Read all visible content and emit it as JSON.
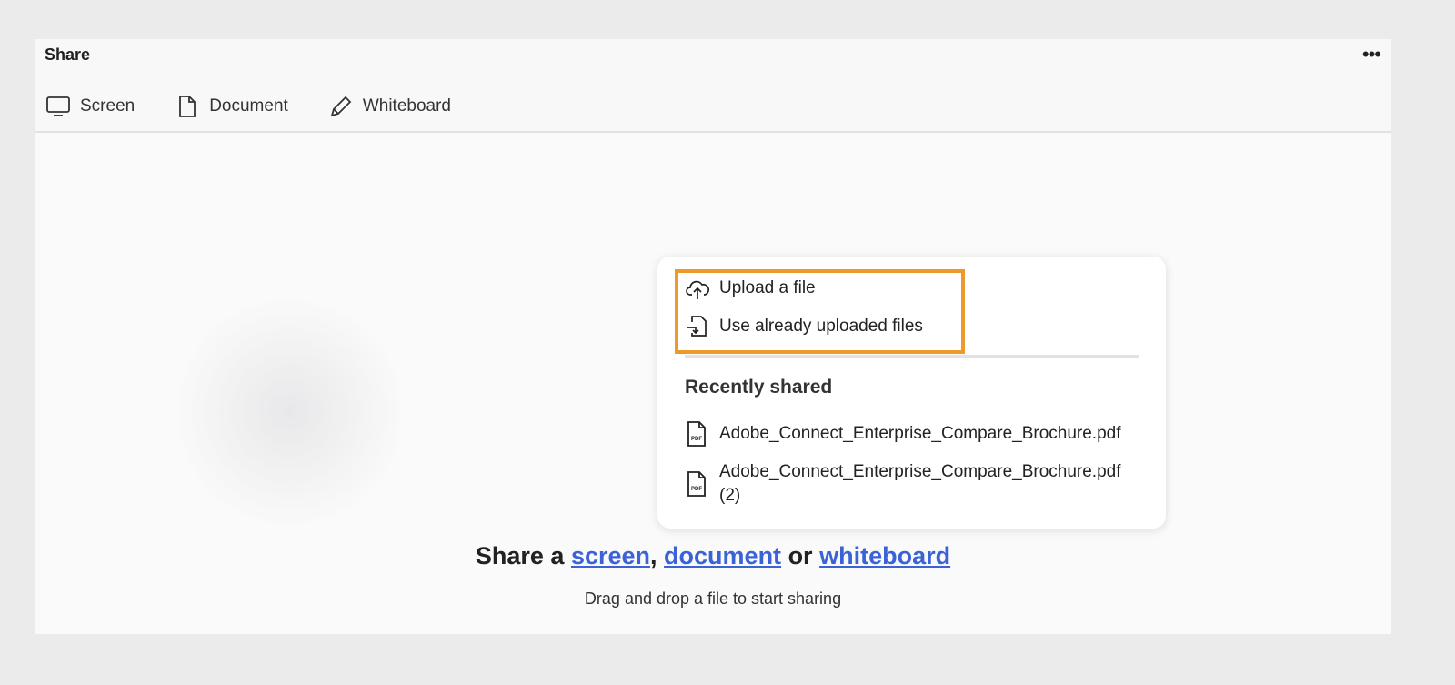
{
  "header": {
    "title": "Share",
    "more_label": "•••"
  },
  "tabs": [
    {
      "label": "Screen"
    },
    {
      "label": "Document"
    },
    {
      "label": "Whiteboard"
    }
  ],
  "popup": {
    "upload_label": "Upload a file",
    "use_uploaded_label": "Use already uploaded files",
    "recent_heading": "Recently shared",
    "recent_files": [
      {
        "name": "Adobe_Connect_Enterprise_Compare_Brochure.pdf",
        "suffix": ""
      },
      {
        "name": "Adobe_Connect_Enterprise_Compare_Brochure.pdf",
        "suffix": "(2)"
      }
    ]
  },
  "main": {
    "cta_prefix": "Share a ",
    "link_screen": "screen",
    "comma": ", ",
    "link_document": "document",
    "or": " or ",
    "link_whiteboard": "whiteboard",
    "subtitle": "Drag and drop a file to start sharing"
  },
  "colors": {
    "highlight": "#ec9a2b",
    "link": "#3b63d8"
  }
}
